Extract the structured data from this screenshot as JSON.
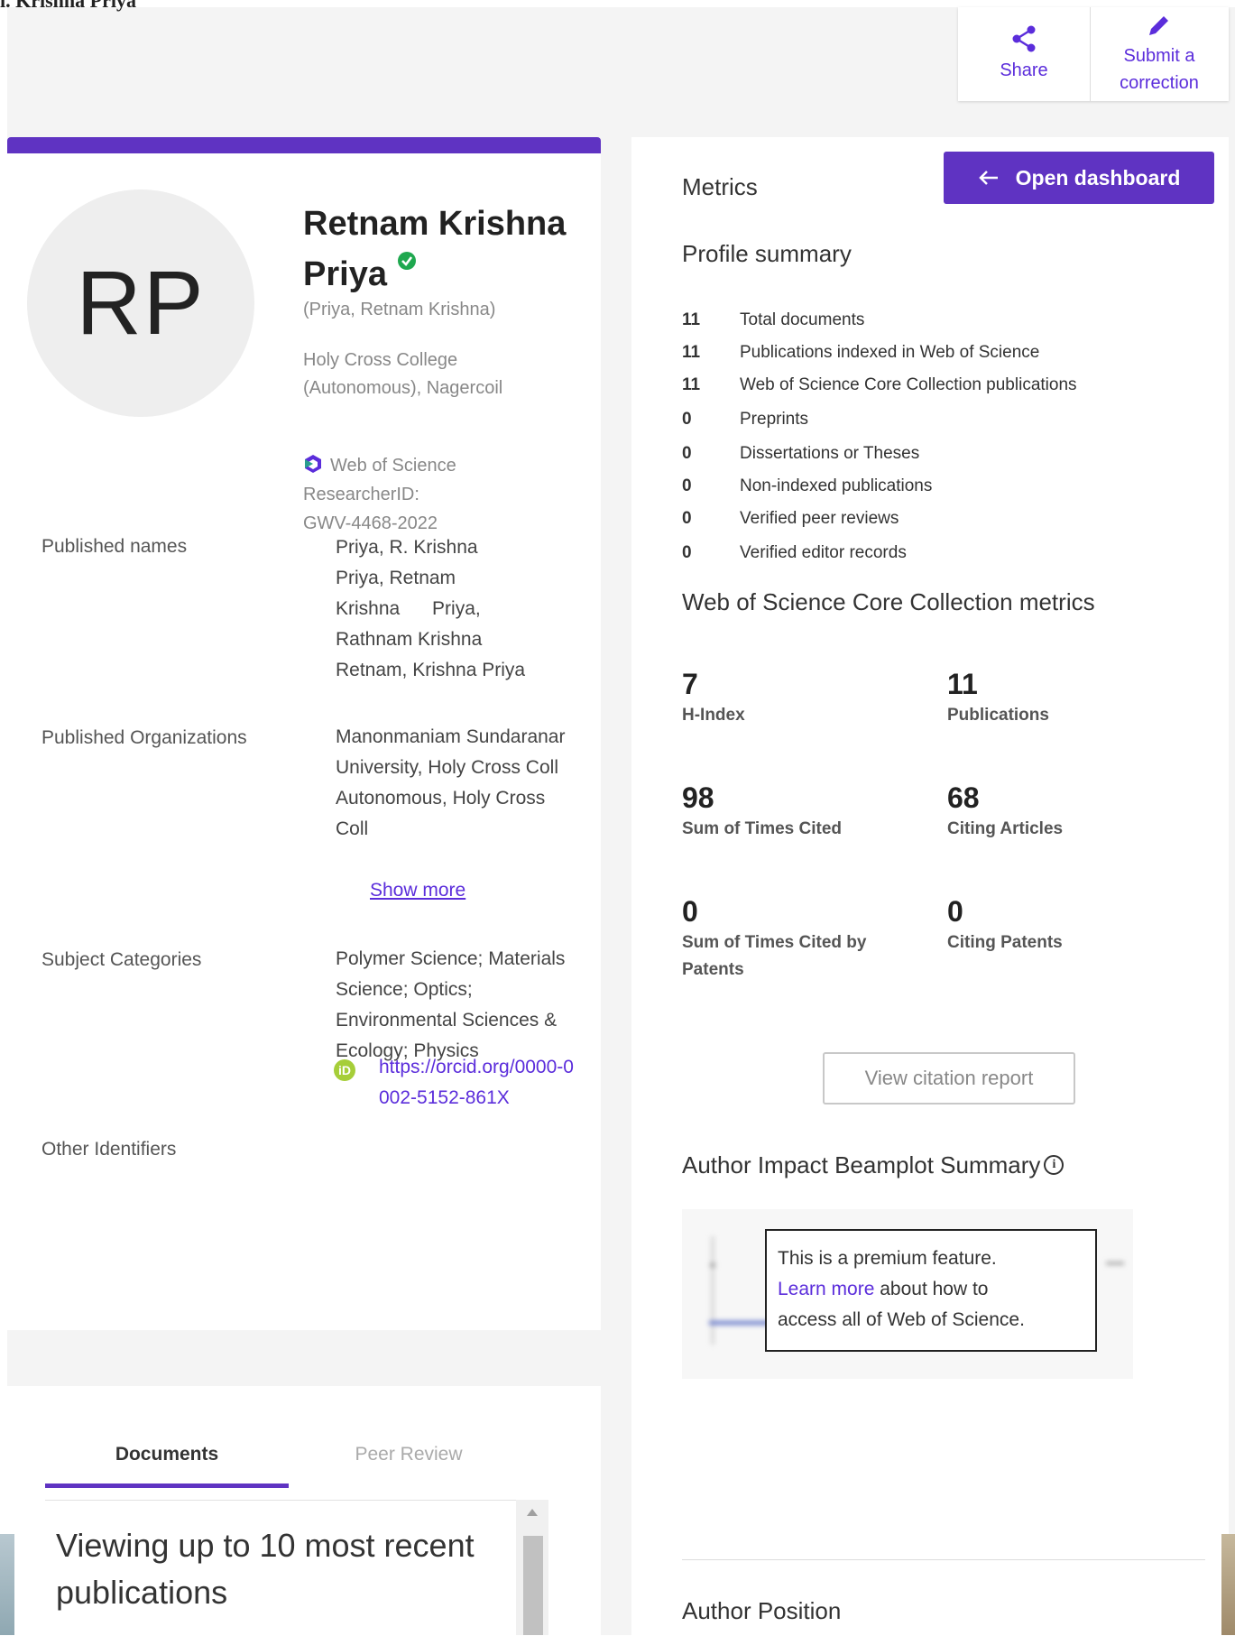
{
  "top_fragment": "ı. Krishna Priya",
  "actions": {
    "share": "Share",
    "correction": "Submit a correction"
  },
  "profile": {
    "initials": "RP",
    "name": "Retnam Krishna Priya",
    "alt_name": "(Priya, Retnam Krishna)",
    "affiliation": "Holy Cross College (Autonomous), Nagercoil",
    "wos_label": "Web of Science",
    "researcherid_label": "ResearcherID:",
    "researcherid": "GWV-4468-2022"
  },
  "details": {
    "published_names_label": "Published names",
    "published_names": [
      "Priya, R. Krishna",
      "Priya, Retnam",
      "Krishna Priya,",
      "Rathnam Krishna",
      "Retnam, Krishna Priya"
    ],
    "orgs_label": "Published Organizations",
    "orgs": "Manonmaniam Sundaranar University, Holy Cross Coll Autonomous, Holy Cross Coll",
    "show_more": "Show more",
    "subjects_label": "Subject Categories",
    "subjects": "Polymer Science; Materials Science; Optics; Environmental Sciences & Ecology; Physics",
    "identifiers_label": "Other Identifiers",
    "orcid_icon": "iD",
    "orcid": "https://orcid.org/0000-0002-5152-861X"
  },
  "metrics": {
    "title": "Metrics",
    "open_dashboard": "Open dashboard",
    "profile_summary_title": "Profile summary",
    "summary": [
      {
        "num": "11",
        "label": "Total documents"
      },
      {
        "num": "11",
        "label": "Publications indexed in Web of Science"
      },
      {
        "num": "11",
        "label": "Web of Science Core Collection publications"
      },
      {
        "num": "0",
        "label": "Preprints"
      },
      {
        "num": "0",
        "label": "Dissertations or Theses"
      },
      {
        "num": "0",
        "label": "Non-indexed publications"
      },
      {
        "num": "0",
        "label": "Verified peer reviews"
      },
      {
        "num": "0",
        "label": "Verified editor records"
      }
    ],
    "core_title": "Web of Science Core Collection metrics",
    "core": [
      {
        "value": "7",
        "label": "H-Index"
      },
      {
        "value": "11",
        "label": "Publications"
      },
      {
        "value": "98",
        "label": "Sum of Times Cited"
      },
      {
        "value": "68",
        "label": "Citing Articles"
      },
      {
        "value": "0",
        "label": "Sum of Times Cited by Patents"
      },
      {
        "value": "0",
        "label": "Citing Patents"
      }
    ],
    "citation_report": "View citation report",
    "beamplot_title": "Author Impact Beamplot Summary",
    "premium_text": "This is a premium feature.",
    "premium_link": "Learn more",
    "premium_rest1": " about how to",
    "premium_rest2": "access all of Web of Science.",
    "author_position": "Author Position"
  },
  "documents": {
    "tab_documents": "Documents",
    "tab_peer_review": "Peer Review",
    "heading": "Viewing up to 10 most recent publications"
  },
  "colors": {
    "accent": "#5f33c2",
    "link": "#5b2ddb",
    "verified": "#1fa84f",
    "orcid": "#a6ce39"
  }
}
